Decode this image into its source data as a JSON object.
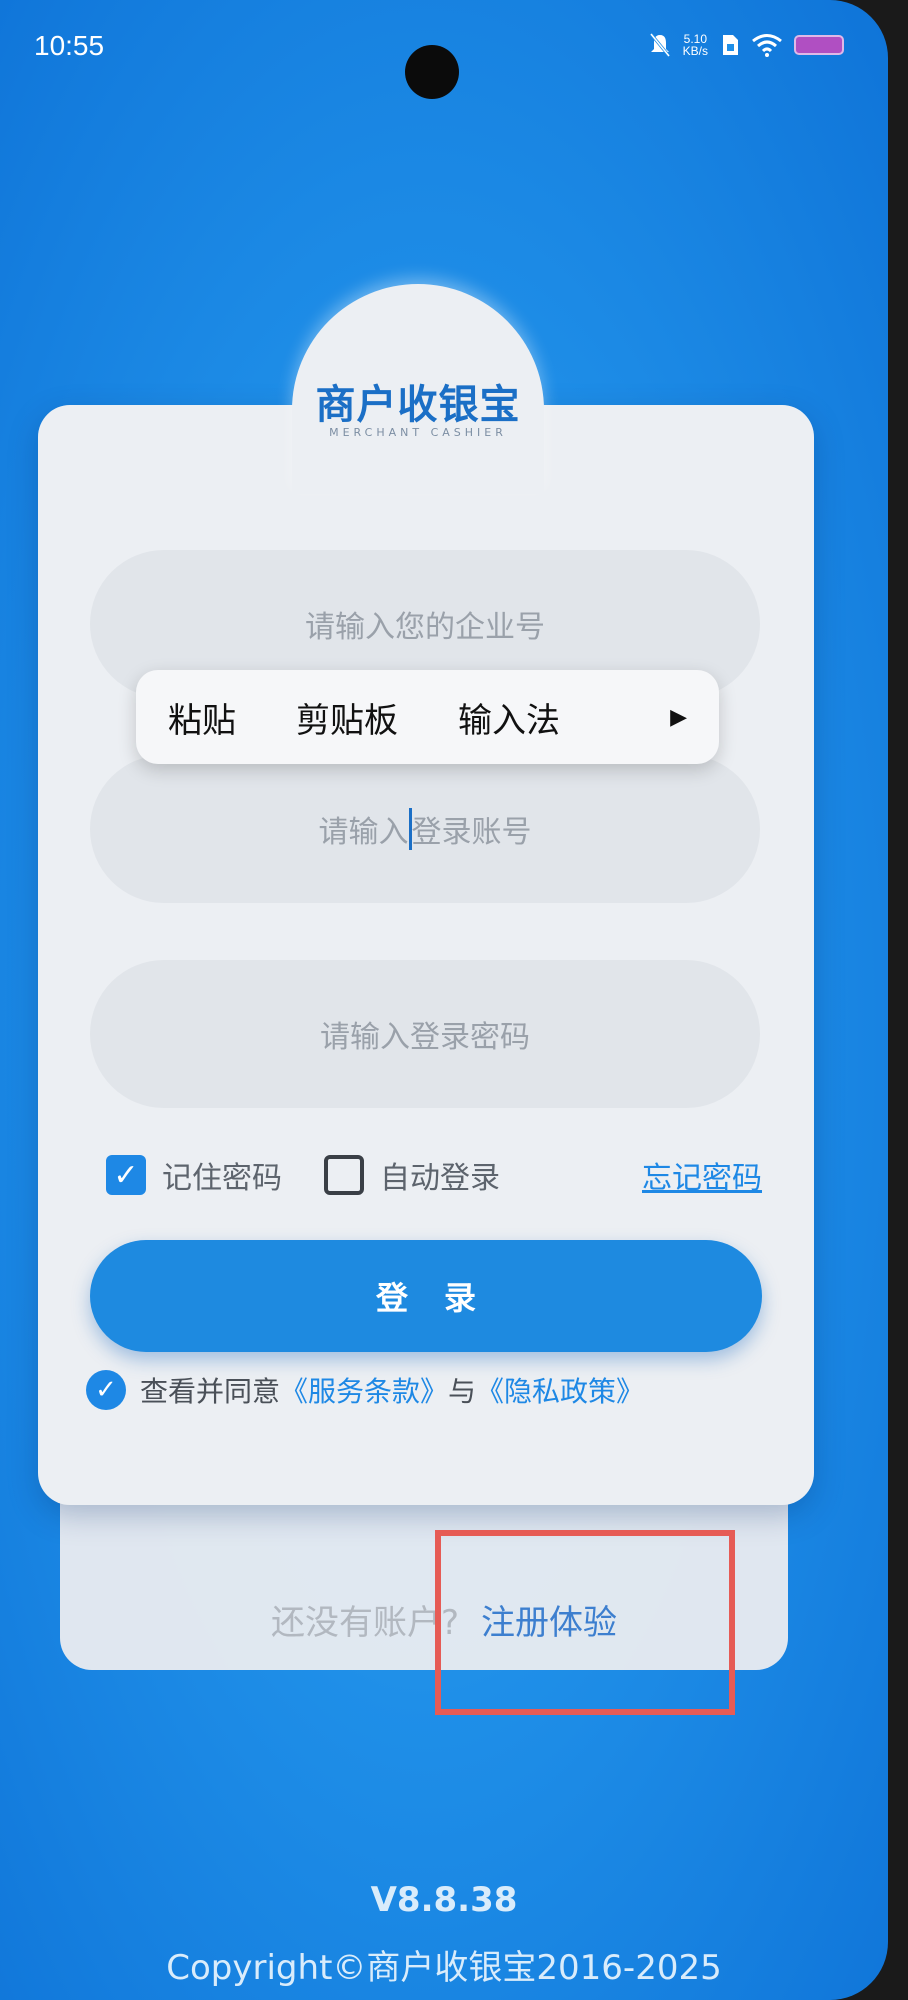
{
  "status_bar": {
    "time": "10:55",
    "net_speed": "5.10",
    "net_unit": "KB/s",
    "icons": [
      "mute-icon",
      "sim-icon",
      "wifi-icon",
      "battery-icon"
    ]
  },
  "logo": {
    "title": "商户收银宝",
    "subtitle": "MERCHANT CASHIER"
  },
  "form": {
    "enterprise_placeholder": "请输入您的企业号",
    "account_placeholder_part1": "请输入",
    "account_placeholder_part2": "登录账号",
    "password_placeholder": "请输入登录密码"
  },
  "context_menu": {
    "items": [
      "粘贴",
      "剪贴板",
      "输入法"
    ],
    "more": "▶"
  },
  "options": {
    "remember_password": "记住密码",
    "remember_checked": true,
    "auto_login": "自动登录",
    "auto_login_checked": false,
    "forgot_password": "忘记密码"
  },
  "login_button": "登录",
  "agreement": {
    "prefix": "查看并同意",
    "terms": "《服务条款》",
    "and": "与",
    "privacy": "《隐私政策》"
  },
  "register": {
    "question": "还没有账户?",
    "link": "注册体验"
  },
  "footer": {
    "version": "V8.8.38",
    "copyright": "Copyright©商户收银宝2016-2025"
  },
  "colors": {
    "accent": "#1e88e5",
    "background": "#1f8fe8",
    "highlight_box": "#e65b55"
  }
}
